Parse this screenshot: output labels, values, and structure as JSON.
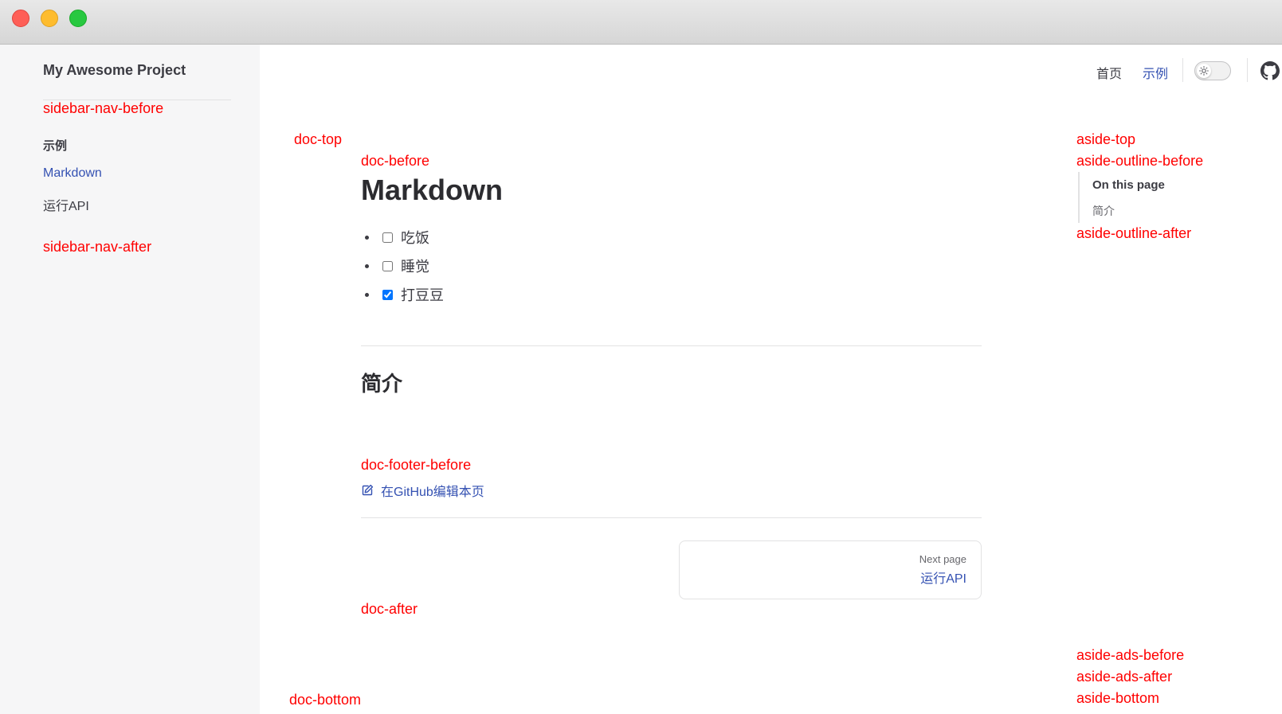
{
  "window": {
    "controls": [
      "close",
      "minimize",
      "maximize"
    ]
  },
  "sidebar": {
    "site_title": "My Awesome Project",
    "slot_before": "sidebar-nav-before",
    "group_title": "示例",
    "items": [
      {
        "label": "Markdown",
        "active": true
      },
      {
        "label": "运行API",
        "active": false
      }
    ],
    "slot_after": "sidebar-nav-after"
  },
  "nav": {
    "links": [
      {
        "label": "首页",
        "active": false
      },
      {
        "label": "示例",
        "active": true
      }
    ],
    "icons": {
      "theme_toggle": "sun-icon",
      "repo": "github-icon"
    }
  },
  "slots": {
    "doc_top": "doc-top",
    "doc_before": "doc-before",
    "doc_footer_before": "doc-footer-before",
    "doc_after": "doc-after",
    "doc_bottom": "doc-bottom",
    "aside_top": "aside-top",
    "aside_outline_before": "aside-outline-before",
    "aside_outline_after": "aside-outline-after",
    "aside_ads_before": "aside-ads-before",
    "aside_ads_after": "aside-ads-after",
    "aside_bottom": "aside-bottom"
  },
  "doc": {
    "title": "Markdown",
    "tasks": [
      {
        "label": "吃饭",
        "checked": false
      },
      {
        "label": "睡觉",
        "checked": false
      },
      {
        "label": "打豆豆",
        "checked": true
      }
    ],
    "section_heading": "简介",
    "edit_link": "在GitHub编辑本页",
    "pager": {
      "desc": "Next page",
      "title": "运行API"
    }
  },
  "outline": {
    "title": "On this page",
    "items": [
      "简介"
    ]
  },
  "colors": {
    "slot": "#ff0000",
    "brand": "#3451b2",
    "sidebar_bg": "#f6f6f7"
  }
}
